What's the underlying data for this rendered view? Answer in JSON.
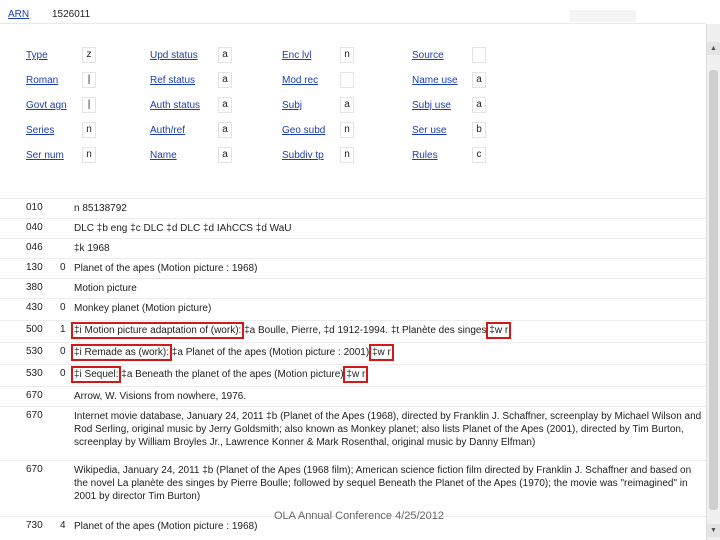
{
  "header": {
    "arn_label": "ARN",
    "arn_value": "1526011"
  },
  "fixed_fields": [
    [
      {
        "label": "Type",
        "value": "z"
      },
      {
        "label": "Upd status",
        "value": "a"
      },
      {
        "label": "Enc lvl",
        "value": "n"
      },
      {
        "label": "Source",
        "value": ""
      }
    ],
    [
      {
        "label": "Roman",
        "value": "|"
      },
      {
        "label": "Ref status",
        "value": "a"
      },
      {
        "label": "Mod rec",
        "value": ""
      },
      {
        "label": "Name use",
        "value": "a"
      }
    ],
    [
      {
        "label": "Govt agn",
        "value": "|"
      },
      {
        "label": "Auth status",
        "value": "a"
      },
      {
        "label": "Subj",
        "value": "a"
      },
      {
        "label": "Subj use",
        "value": "a"
      }
    ],
    [
      {
        "label": "Series",
        "value": "n"
      },
      {
        "label": "Auth/ref",
        "value": "a"
      },
      {
        "label": "Geo subd",
        "value": "n"
      },
      {
        "label": "Ser use",
        "value": "b"
      }
    ],
    [
      {
        "label": "Ser num",
        "value": "n"
      },
      {
        "label": "Name",
        "value": "a"
      },
      {
        "label": "Subdiv tp",
        "value": "n"
      },
      {
        "label": "Rules",
        "value": "c"
      }
    ]
  ],
  "fields": [
    {
      "tag": "010",
      "ind": "",
      "text": "n  85138792"
    },
    {
      "tag": "040",
      "ind": "",
      "text": "DLC ‡b eng ‡c DLC ‡d DLC ‡d IAhCCS ‡d WaU"
    },
    {
      "tag": "046",
      "ind": "",
      "text": "‡k 1968"
    },
    {
      "tag": "130",
      "ind": "0",
      "text": "Planet of the apes (Motion picture : 1968)"
    },
    {
      "tag": "380",
      "ind": "",
      "text": "Motion picture"
    },
    {
      "tag": "430",
      "ind": "0",
      "text": "Monkey planet (Motion picture)"
    },
    {
      "tag": "500",
      "ind": "1",
      "p1": "‡i Motion picture adaptation of (work):",
      "p2": " ‡a Boulle, Pierre, ‡d 1912-1994. ‡t Planète des singes ",
      "p3": "‡w r"
    },
    {
      "tag": "530",
      "ind": "0",
      "p1": "‡i Remade as (work):",
      "p2": " ‡a Planet of the apes (Motion picture : 2001) ",
      "p3": "‡w r"
    },
    {
      "tag": "530",
      "ind": "0",
      "p1": "‡i Sequel:",
      "p2": " ‡a Beneath the planet of the apes (Motion picture) ",
      "p3": "‡w r"
    },
    {
      "tag": "670",
      "ind": "",
      "text": "Arrow, W. Visions from nowhere, 1976."
    },
    {
      "tag": "670",
      "ind": "",
      "text": "Internet movie database, January 24, 2011 ‡b (Planet of the Apes (1968), directed by Franklin J. Schaffner, screenplay by Michael Wilson and Rod Serling, original music by Jerry Goldsmith; also known as Monkey planet; also lists Planet of the Apes (2001), directed by Tim Burton, screenplay by William Broyles Jr., Lawrence Konner & Mark Rosenthal, original music by Danny Elfman)"
    },
    {
      "tag": "670",
      "ind": "",
      "text": "Wikipedia, January 24, 2011 ‡b (Planet of the Apes (1968 film); American science fiction film directed by Franklin J. Schaffner and based on the novel La planète des singes by Pierre Boulle; followed by sequel Beneath the Planet of the Apes (1970); the movie was \"reimagined\" in 2001 by director Tim Burton)"
    },
    {
      "tag": "730",
      "ind": "4",
      "text": "Planet of the apes (Motion picture : 1968)"
    }
  ],
  "footer": "OLA Annual Conference 4/25/2012",
  "scrollbar": {
    "up": "▲",
    "down": "▼"
  }
}
